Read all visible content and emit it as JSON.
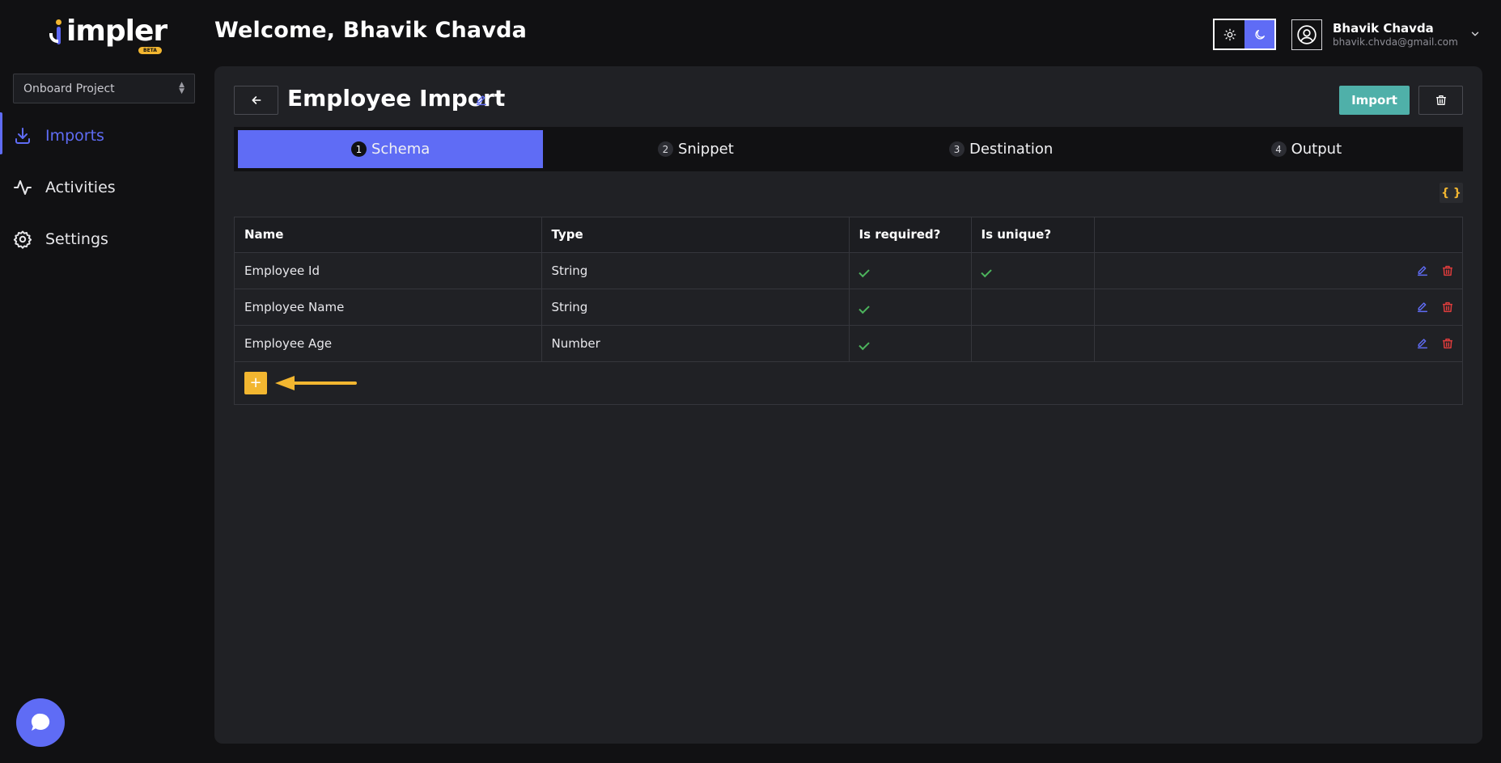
{
  "app": {
    "logo_text": "impler",
    "beta_badge": "BETA"
  },
  "sidebar": {
    "project_select": {
      "value": "Onboard Project"
    },
    "items": [
      {
        "label": "Imports",
        "icon": "download-icon",
        "active": true
      },
      {
        "label": "Activities",
        "icon": "activity-icon",
        "active": false
      },
      {
        "label": "Settings",
        "icon": "gear-icon",
        "active": false
      }
    ]
  },
  "header": {
    "welcome": "Welcome, Bhavik Chavda",
    "theme": {
      "light_icon": "sun-icon",
      "dark_icon": "moon-icon",
      "selected": "dark"
    },
    "user": {
      "name": "Bhavik Chavda",
      "email": "bhavik.chvda@gmail.com"
    }
  },
  "page": {
    "title": "Employee Import",
    "import_label": "Import",
    "json_label": "{ }",
    "steps": [
      {
        "num": "1",
        "label": "Schema",
        "active": true
      },
      {
        "num": "2",
        "label": "Snippet",
        "active": false
      },
      {
        "num": "3",
        "label": "Destination",
        "active": false
      },
      {
        "num": "4",
        "label": "Output",
        "active": false
      }
    ],
    "table": {
      "headers": [
        "Name",
        "Type",
        "Is required?",
        "Is unique?",
        ""
      ],
      "rows": [
        {
          "name": "Employee Id",
          "type": "String",
          "required": true,
          "unique": true
        },
        {
          "name": "Employee Name",
          "type": "String",
          "required": true,
          "unique": false
        },
        {
          "name": "Employee Age",
          "type": "Number",
          "required": true,
          "unique": false
        }
      ],
      "add_label": "+"
    }
  },
  "colors": {
    "accent": "#5f6cf5",
    "import_button": "#4fb0a9",
    "add_button": "#f2b630",
    "delete_icon": "#e03c3c",
    "check": "#4cb35c"
  }
}
